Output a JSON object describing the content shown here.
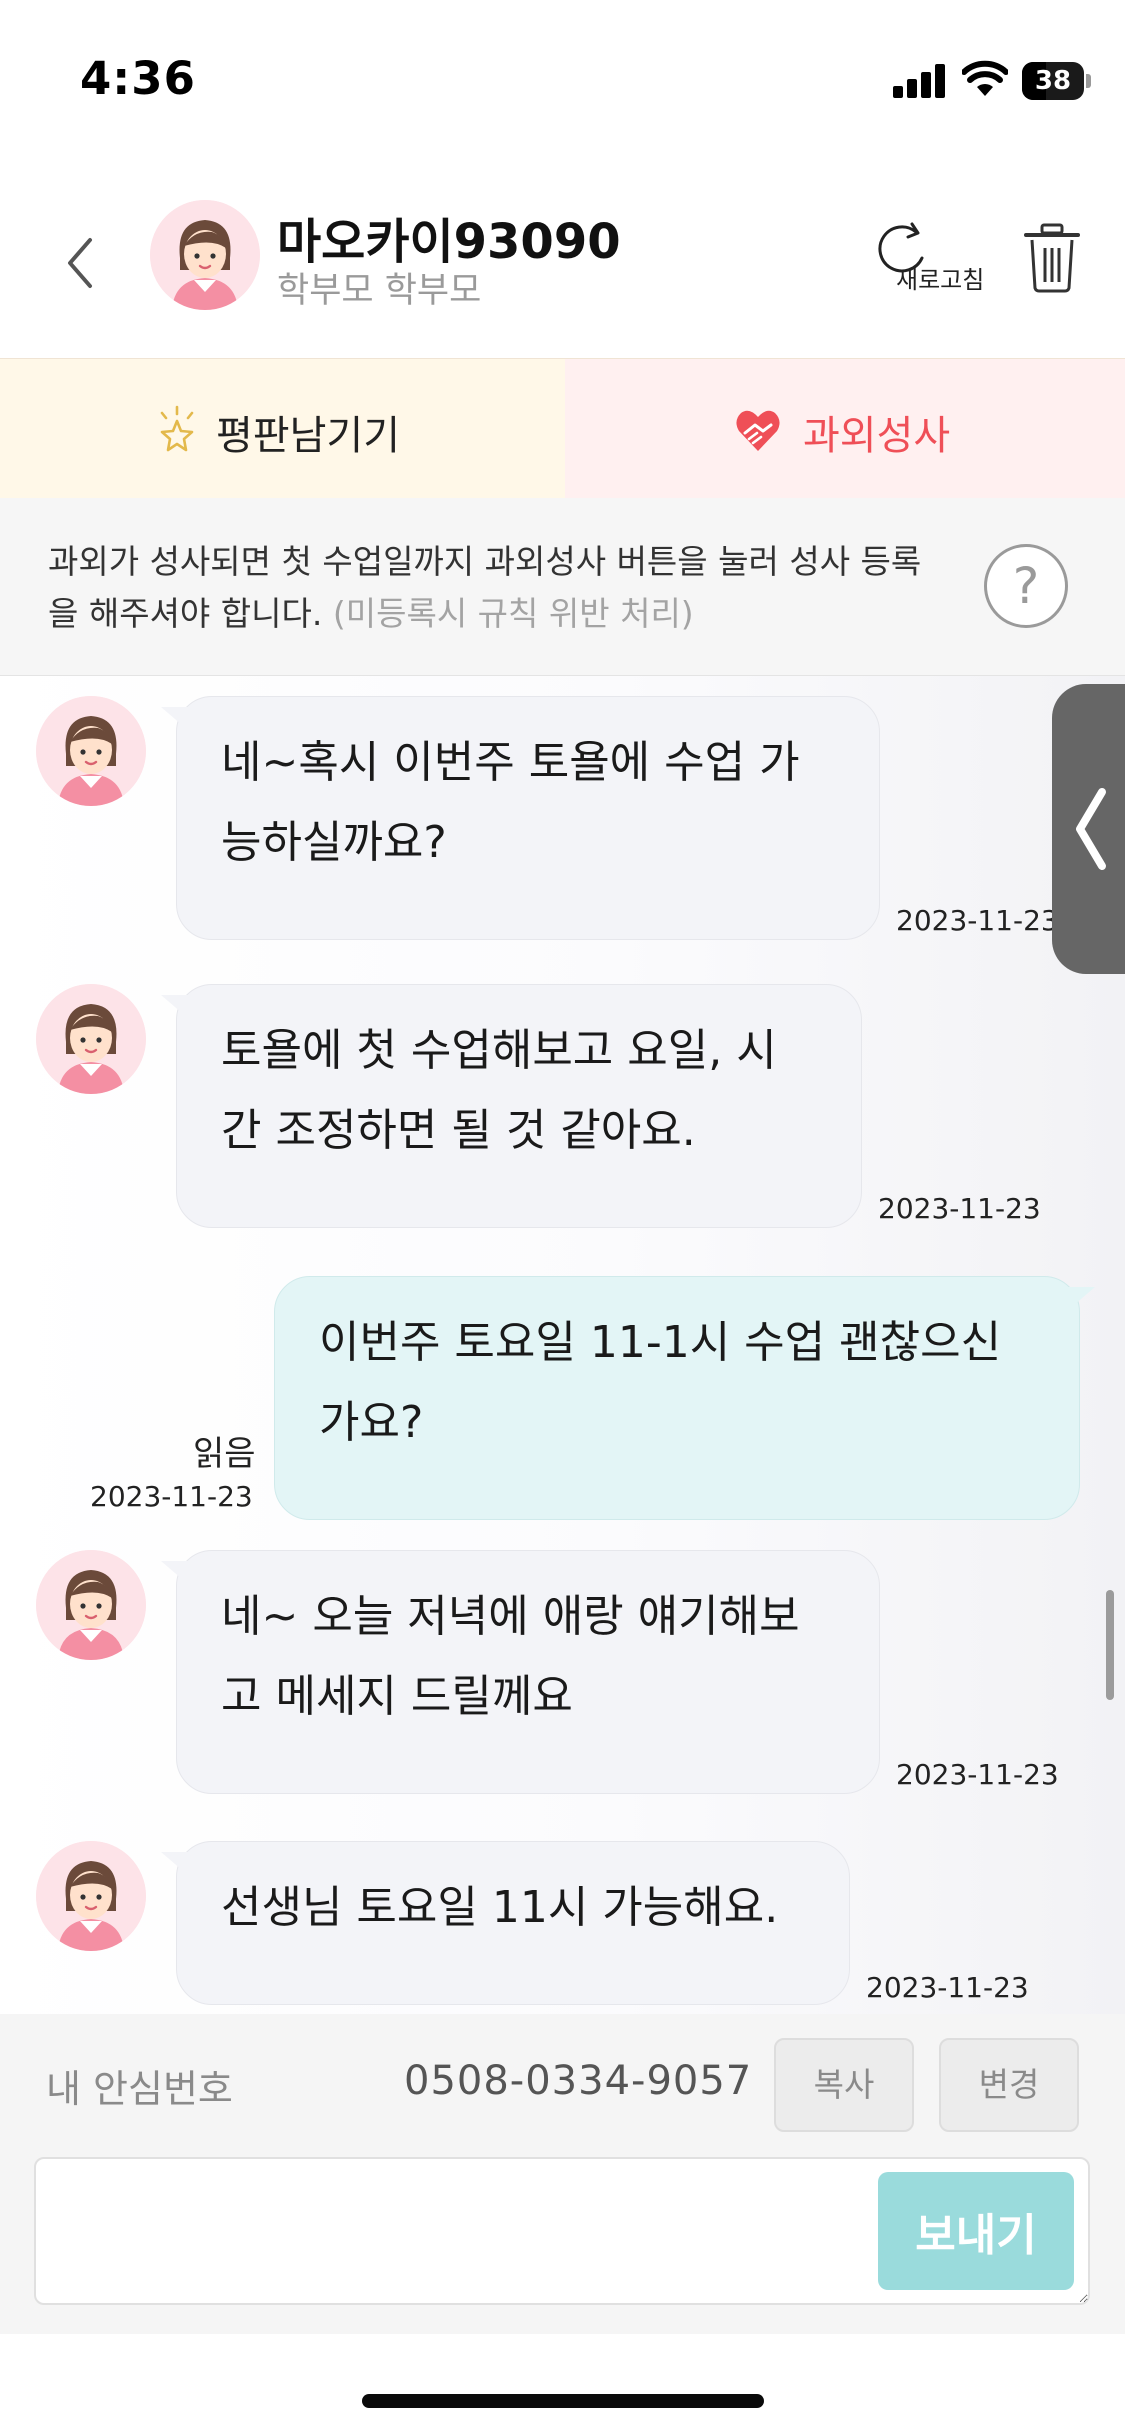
{
  "status_bar": {
    "time": "4:36",
    "battery": "38",
    "battery_level": 0.38
  },
  "header": {
    "contact_name": "마오카이93090",
    "contact_role": "학부모 학부모",
    "refresh_label": "새로고침",
    "icons": {
      "back": "chevron-left-icon",
      "refresh": "refresh-icon",
      "trash": "trash-icon"
    }
  },
  "action_tabs": {
    "review_label": "평판남기기",
    "success_label": "과외성사",
    "colors": {
      "review_bg": "#fff8e8",
      "success_bg": "#fff0f0",
      "success_text": "#ef4f57"
    }
  },
  "notice": {
    "text": "과외가 성사되면 첫 수업일까지 과외성사 버튼을 눌러 성사 등록을 해주셔야 합니다.",
    "muted": "(미등록시 규칙 위반 처리)",
    "help_symbol": "?"
  },
  "messages": [
    {
      "side": "in",
      "lines": [
        "네~혹시 이번주 토욜에 수업 가",
        "능하실까요?"
      ],
      "time": "2023-11-23"
    },
    {
      "side": "in",
      "lines": [
        "토욜에 첫 수업해보고 요일, 시",
        "간 조정하면 될 것 같아요."
      ],
      "time": "2023-11-23"
    },
    {
      "side": "out",
      "lines": [
        "이번주 토요일 11-1시 수업 괜찮으신",
        "가요?"
      ],
      "time": "2023-11-23",
      "read": "읽음"
    },
    {
      "side": "in",
      "lines": [
        "네~ 오늘 저녁에 애랑 얘기해보",
        "고 메세지 드릴께요"
      ],
      "time": "2023-11-23"
    },
    {
      "side": "in",
      "lines": [
        "선생님 토요일 11시 가능해요."
      ],
      "time": "2023-11-23"
    }
  ],
  "safe_number": {
    "label": "내 안심번호",
    "number": "0508-0334-9057",
    "copy_label": "복사",
    "change_label": "변경"
  },
  "composer": {
    "value": "",
    "placeholder": "",
    "send_label": "보내기"
  },
  "colors": {
    "accent": "#9adbdc",
    "bubble_in": "#f3f4f8",
    "bubble_out": "#e3f5f6"
  }
}
